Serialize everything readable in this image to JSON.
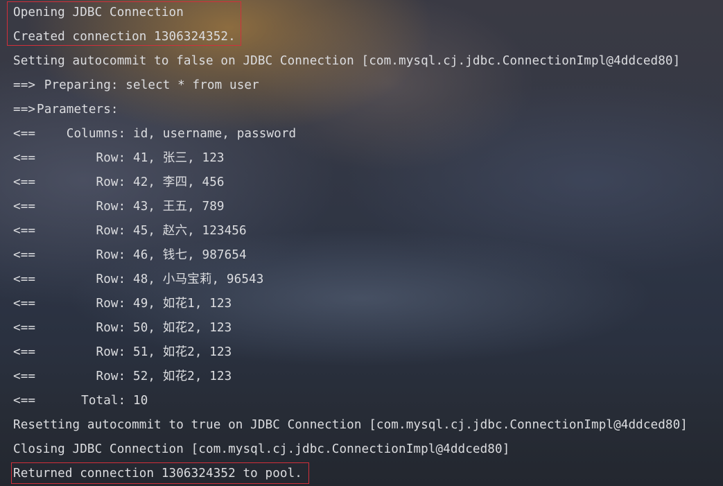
{
  "console": {
    "line_opening": "Opening JDBC Connection",
    "line_created": "Created connection 1306324352.",
    "line_autocommit_false": "Setting autocommit to false on JDBC Connection [com.mysql.cj.jdbc.ConnectionImpl@4ddced80]",
    "preparing": {
      "arrow": "==>",
      "text": " Preparing: select * from user"
    },
    "parameters": {
      "arrow": "==>",
      "text": "Parameters:"
    },
    "columns": {
      "arrow": "<==",
      "text": "    Columns: id, username, password"
    },
    "rows": [
      {
        "arrow": "<==",
        "text": "        Row: 41, 张三, 123"
      },
      {
        "arrow": "<==",
        "text": "        Row: 42, 李四, 456"
      },
      {
        "arrow": "<==",
        "text": "        Row: 43, 王五, 789"
      },
      {
        "arrow": "<==",
        "text": "        Row: 45, 赵六, 123456"
      },
      {
        "arrow": "<==",
        "text": "        Row: 46, 钱七, 987654"
      },
      {
        "arrow": "<==",
        "text": "        Row: 48, 小马宝莉, 96543"
      },
      {
        "arrow": "<==",
        "text": "        Row: 49, 如花1, 123"
      },
      {
        "arrow": "<==",
        "text": "        Row: 50, 如花2, 123"
      },
      {
        "arrow": "<==",
        "text": "        Row: 51, 如花2, 123"
      },
      {
        "arrow": "<==",
        "text": "        Row: 52, 如花2, 123"
      }
    ],
    "total": {
      "arrow": "<==",
      "text": "      Total: 10"
    },
    "line_autocommit_true": "Resetting autocommit to true on JDBC Connection [com.mysql.cj.jdbc.ConnectionImpl@4ddced80]",
    "line_closing": "Closing JDBC Connection [com.mysql.cj.jdbc.ConnectionImpl@4ddced80]",
    "line_returned": "Returned connection 1306324352 to pool."
  },
  "colors": {
    "text": "#dcdde0",
    "highlight_border": "#d32f3a"
  }
}
